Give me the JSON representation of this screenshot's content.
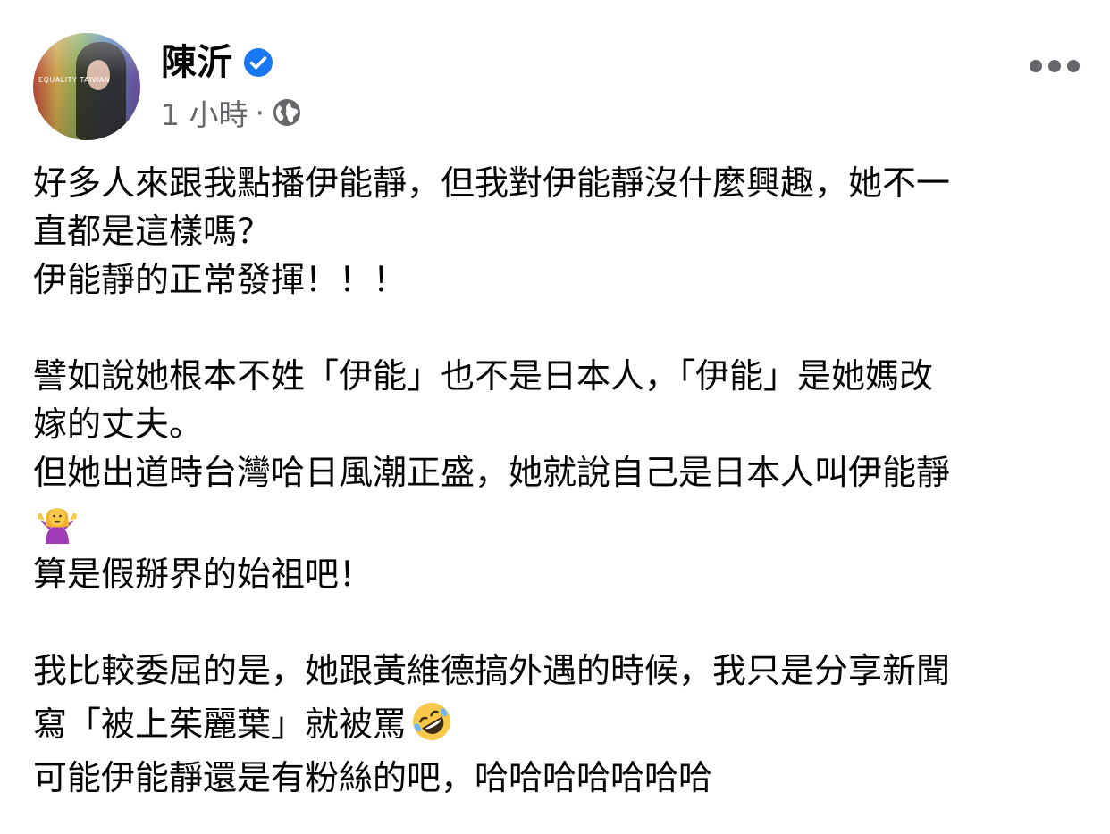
{
  "post": {
    "author_name": "陳沂",
    "timestamp": "1 小時",
    "meta_separator": "·",
    "avatar_text": "EQUALITY TAIWAN",
    "icons": {
      "verified": "verified-badge-icon",
      "audience": "globe-icon",
      "more": "more-options-icon",
      "emoji_1": "person-shrugging-emoji",
      "emoji_2": "rolling-on-floor-laughing-emoji"
    },
    "colors": {
      "verified_blue": "#1877f2",
      "secondary_text": "#65676b",
      "primary_text": "#050505"
    },
    "body_lines": [
      "好多人來跟我點播伊能靜，但我對伊能靜沒什麼興趣，她不一",
      "直都是這樣嗎？",
      "伊能靜的正常發揮！！！",
      "",
      "譬如說她根本不姓「伊能」也不是日本人，「伊能」是她媽改",
      "嫁的丈夫。",
      "但她出道時台灣哈日風潮正盛，她就說自己是日本人叫伊能靜",
      "算是假掰界的始祖吧！",
      "",
      "我比較委屈的是，她跟黃維德搞外遇的時候，我只是分享新聞",
      "寫「被上茱麗葉」就被罵",
      "可能伊能靜還是有粉絲的吧，哈哈哈哈哈哈哈"
    ]
  }
}
